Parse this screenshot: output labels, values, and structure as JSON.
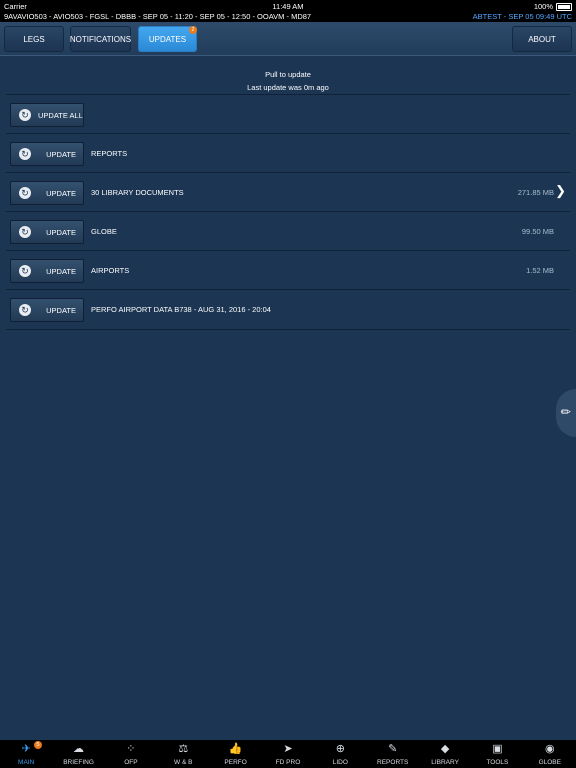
{
  "status_bar": {
    "carrier": "Carrier",
    "time": "11:49 AM",
    "battery": "100%",
    "flight_info": "9AVAVIO503 - AVIO503 - FGSL - DBBB - SEP 05 - 11:20 - SEP 05 - 12:50 - OOAVM - MD87",
    "user_info": "ABTEST - SEP 05 09:49 UTC"
  },
  "top_nav": {
    "legs": "LEGS",
    "notifications": "NOTIFICATIONS",
    "updates": "UPDATES",
    "updates_badge": "2",
    "about": "ABOUT"
  },
  "main": {
    "pull_to_update": "Pull to update",
    "last_update": "Last update was 0m ago",
    "update_all_label": "UPDATE ALL",
    "rows": [
      {
        "button": "UPDATE",
        "label": "REPORTS",
        "size": ""
      },
      {
        "button": "UPDATE",
        "label": "30 LIBRARY DOCUMENTS",
        "size": "271.85 MB"
      },
      {
        "button": "UPDATE",
        "label": "GLOBE",
        "size": "99.50 MB"
      },
      {
        "button": "UPDATE",
        "label": "AIRPORTS",
        "size": "1.52 MB"
      },
      {
        "button": "UPDATE",
        "label": "PERFO AIRPORT DATA B738 - AUG 31, 2016 - 20:04",
        "size": ""
      }
    ]
  },
  "tab_bar": {
    "main_badge": "5",
    "tabs": [
      {
        "label": "MAIN",
        "icon": "airplane-icon"
      },
      {
        "label": "BRIEFING",
        "icon": "weather-cloud-icon"
      },
      {
        "label": "OFP",
        "icon": "route-dots-icon"
      },
      {
        "label": "W & B",
        "icon": "scale-icon"
      },
      {
        "label": "PERFO",
        "icon": "thumbs-up-icon"
      },
      {
        "label": "FD PRO",
        "icon": "navigation-arrow-icon"
      },
      {
        "label": "LIDO",
        "icon": "lido-compass-icon"
      },
      {
        "label": "REPORTS",
        "icon": "clipboard-pencil-icon"
      },
      {
        "label": "LIBRARY",
        "icon": "book-icon"
      },
      {
        "label": "TOOLS",
        "icon": "toolbox-icon"
      },
      {
        "label": "GLOBE",
        "icon": "globe-icon"
      }
    ]
  },
  "colors": {
    "background": "#1b3553",
    "active_blue": "#3b9cf0",
    "badge_orange": "#e87a1d",
    "size_text": "#a9bdd2"
  }
}
